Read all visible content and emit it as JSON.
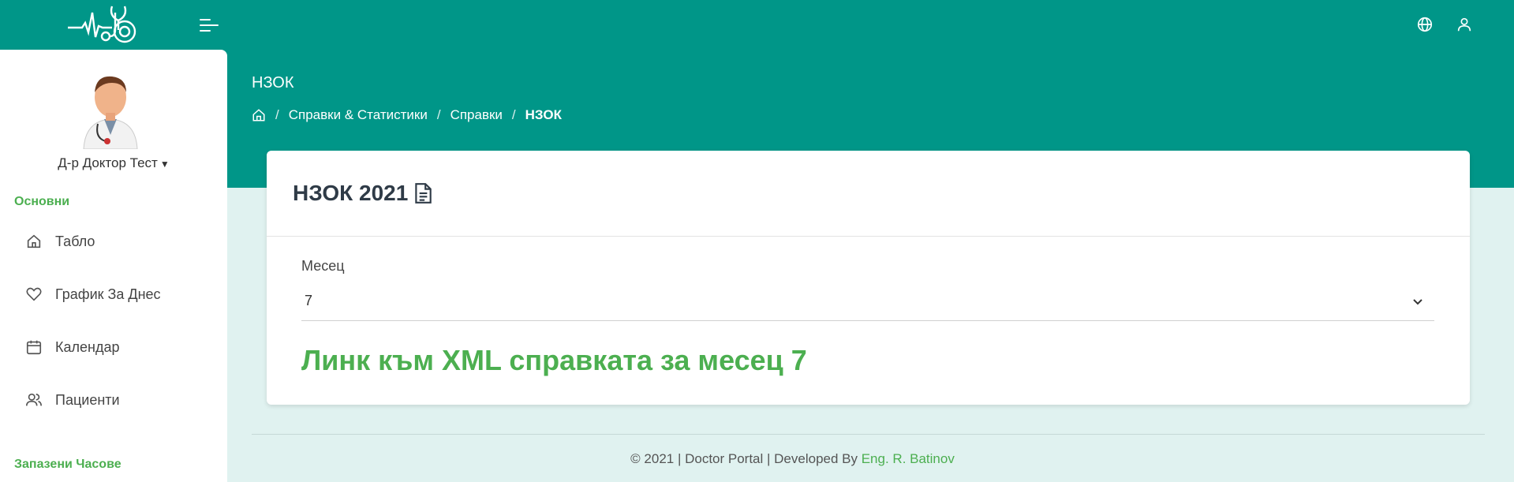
{
  "header": {
    "page_title": "НЗОК",
    "breadcrumb": [
      "Справки & Статистики",
      "Справки",
      "НЗОК"
    ]
  },
  "sidebar": {
    "user_name": "Д-р Доктор Тест",
    "section_main": "Основни",
    "items": [
      {
        "label": "Табло",
        "icon": "home-icon"
      },
      {
        "label": "График За Днес",
        "icon": "heart-icon"
      },
      {
        "label": "Календар",
        "icon": "calendar-icon"
      },
      {
        "label": "Пациенти",
        "icon": "users-icon"
      }
    ],
    "section_reserved": "Запазени Часове"
  },
  "card": {
    "title": "НЗОК 2021",
    "month_label": "Месец",
    "month_value": "7",
    "xml_link": "Линк към XML справката за месец 7"
  },
  "footer": {
    "text": "© 2021 | Doctor Portal | Developed By ",
    "author_link": "Eng. R. Batinov"
  },
  "colors": {
    "primary": "#009688",
    "accent": "#4caf50",
    "background": "#e0f2f0"
  }
}
